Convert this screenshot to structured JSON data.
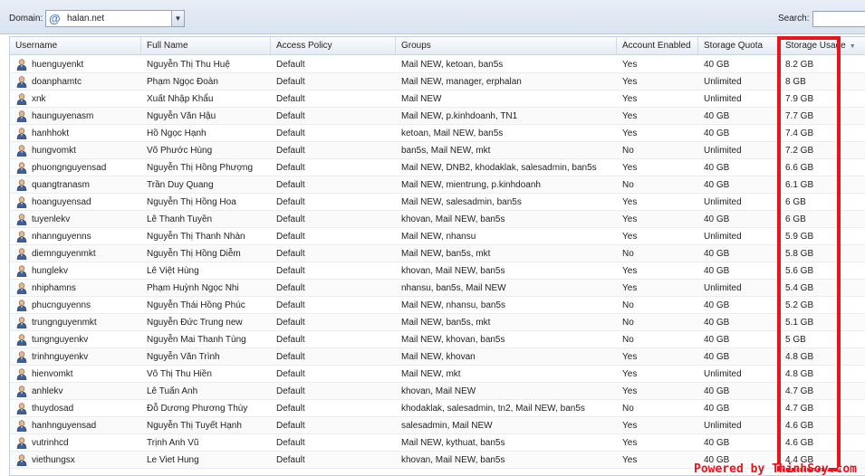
{
  "toolbar": {
    "domain_label": "Domain:",
    "domain_value": "halan.net",
    "search_label": "Search:",
    "search_value": ""
  },
  "icons": {
    "domain": "at-icon",
    "dropdown": "chevron-down-icon",
    "user": "user-icon",
    "sort": "sort-descending-icon"
  },
  "colors": {
    "highlight": "#e8141e",
    "toolbar_bg": "#dfe7f3"
  },
  "grid": {
    "columns": [
      "Username",
      "Full Name",
      "Access Policy",
      "Groups",
      "Account Enabled",
      "Storage Quota",
      "Storage Usage"
    ],
    "sorted_column": "Storage Usage",
    "rows": [
      [
        "huenguyenkt",
        "Nguyễn Thị Thu Huệ",
        "Default",
        "Mail NEW, ketoan, ban5s",
        "Yes",
        "40 GB",
        "8.2 GB"
      ],
      [
        "doanphamtc",
        "Phạm Ngọc Đoàn",
        "Default",
        "Mail NEW, manager, erphalan",
        "Yes",
        "Unlimited",
        "8 GB"
      ],
      [
        "xnk",
        "Xuất Nhập Khẩu",
        "Default",
        "Mail NEW",
        "Yes",
        "Unlimited",
        "7.9 GB"
      ],
      [
        "haunguyenasm",
        "Nguyễn Văn Hậu",
        "Default",
        "Mail NEW, p.kinhdoanh, TN1",
        "Yes",
        "40 GB",
        "7.7 GB"
      ],
      [
        "hanhhokt",
        "Hồ Ngọc Hạnh",
        "Default",
        "ketoan, Mail NEW, ban5s",
        "Yes",
        "40 GB",
        "7.4 GB"
      ],
      [
        "hungvomkt",
        "Võ Phước Hùng",
        "Default",
        "ban5s, Mail NEW, mkt",
        "No",
        "Unlimited",
        "7.2 GB"
      ],
      [
        "phuongnguyensad",
        "Nguyễn Thị Hồng Phượng",
        "Default",
        "Mail NEW, DNB2, khodaklak, salesadmin, ban5s",
        "Yes",
        "40 GB",
        "6.6 GB"
      ],
      [
        "quangtranasm",
        "Trần Duy Quang",
        "Default",
        "Mail NEW, mientrung, p.kinhdoanh",
        "No",
        "40 GB",
        "6.1 GB"
      ],
      [
        "hoanguyensad",
        "Nguyễn Thị Hồng Hoa",
        "Default",
        "Mail NEW, salesadmin, ban5s",
        "Yes",
        "Unlimited",
        "6 GB"
      ],
      [
        "tuyenlekv",
        "Lê Thanh Tuyền",
        "Default",
        "khovan, Mail NEW, ban5s",
        "Yes",
        "40 GB",
        "6 GB"
      ],
      [
        "nhannguyenns",
        "Nguyễn Thị Thanh Nhàn",
        "Default",
        "Mail NEW, nhansu",
        "Yes",
        "Unlimited",
        "5.9 GB"
      ],
      [
        "diemnguyenmkt",
        "Nguyễn Thị Hồng Diễm",
        "Default",
        "Mail NEW, ban5s, mkt",
        "No",
        "40 GB",
        "5.8 GB"
      ],
      [
        "hunglekv",
        "Lê Việt Hùng",
        "Default",
        "khovan, Mail NEW, ban5s",
        "Yes",
        "40 GB",
        "5.6 GB"
      ],
      [
        "nhiphamns",
        "Phạm Huỳnh Ngọc Nhi",
        "Default",
        "nhansu, ban5s, Mail NEW",
        "Yes",
        "Unlimited",
        "5.4 GB"
      ],
      [
        "phucnguyenns",
        "Nguyễn Thái Hồng Phúc",
        "Default",
        "Mail NEW, nhansu, ban5s",
        "No",
        "40 GB",
        "5.2 GB"
      ],
      [
        "trungnguyenmkt",
        "Nguyễn Đức Trung new",
        "Default",
        "Mail NEW, ban5s, mkt",
        "No",
        "40 GB",
        "5.1 GB"
      ],
      [
        "tungnguyenkv",
        "Nguyễn Mai Thanh Tùng",
        "Default",
        "Mail NEW, khovan, ban5s",
        "No",
        "40 GB",
        "5 GB"
      ],
      [
        "trinhnguyenkv",
        "Nguyễn Văn Trình",
        "Default",
        "Mail NEW, khovan",
        "Yes",
        "40 GB",
        "4.8 GB"
      ],
      [
        "hienvomkt",
        "Võ Thị Thu Hiền",
        "Default",
        "Mail NEW, mkt",
        "Yes",
        "Unlimited",
        "4.8 GB"
      ],
      [
        "anhlekv",
        "Lê Tuấn Anh",
        "Default",
        "khovan, Mail NEW",
        "Yes",
        "40 GB",
        "4.7 GB"
      ],
      [
        "thuydosad",
        "Đỗ Dương Phương Thùy",
        "Default",
        "khodaklak, salesadmin, tn2, Mail NEW, ban5s",
        "No",
        "40 GB",
        "4.7 GB"
      ],
      [
        "hanhnguyensad",
        "Nguyễn Thị Tuyết Hạnh",
        "Default",
        "salesadmin, Mail NEW",
        "Yes",
        "Unlimited",
        "4.6 GB"
      ],
      [
        "vutrinhcd",
        "Trịnh Anh Vũ",
        "Default",
        "Mail NEW, kythuat, ban5s",
        "Yes",
        "40 GB",
        "4.6 GB"
      ],
      [
        "viethungsx",
        "Le Viet Hung",
        "Default",
        "khovan, Mail NEW, ban5s",
        "Yes",
        "40 GB",
        "4.4 GB"
      ]
    ]
  },
  "watermark": "Powered by ThinhSoy.com"
}
